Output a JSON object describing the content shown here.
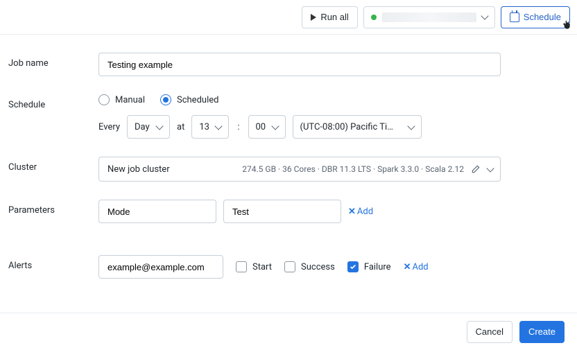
{
  "topbar": {
    "run_all_label": "Run all",
    "schedule_button_label": "Schedule"
  },
  "form": {
    "job_name": {
      "label": "Job name",
      "value": "Testing example"
    },
    "schedule": {
      "label": "Schedule",
      "mode_manual": "Manual",
      "mode_scheduled": "Scheduled",
      "selected_mode": "scheduled",
      "every_label": "Every",
      "at_label": "at",
      "colon": ":",
      "interval_unit": "Day",
      "hour": "13",
      "minute": "00",
      "timezone": "(UTC-08:00) Pacific Ti…"
    },
    "cluster": {
      "label": "Cluster",
      "name": "New job cluster",
      "spec": "274.5 GB · 36 Cores · DBR 11.3 LTS · Spark 3.3.0 · Scala 2.12"
    },
    "parameters": {
      "label": "Parameters",
      "items": [
        {
          "key": "Mode",
          "value": "Test"
        }
      ],
      "add_label": "Add"
    },
    "alerts": {
      "label": "Alerts",
      "email": "example@example.com",
      "start_label": "Start",
      "success_label": "Success",
      "failure_label": "Failure",
      "start_checked": false,
      "success_checked": false,
      "failure_checked": true,
      "add_label": "Add"
    }
  },
  "footer": {
    "cancel_label": "Cancel",
    "create_label": "Create"
  },
  "colors": {
    "primary": "#2374e1",
    "border": "#c7d0d8"
  }
}
